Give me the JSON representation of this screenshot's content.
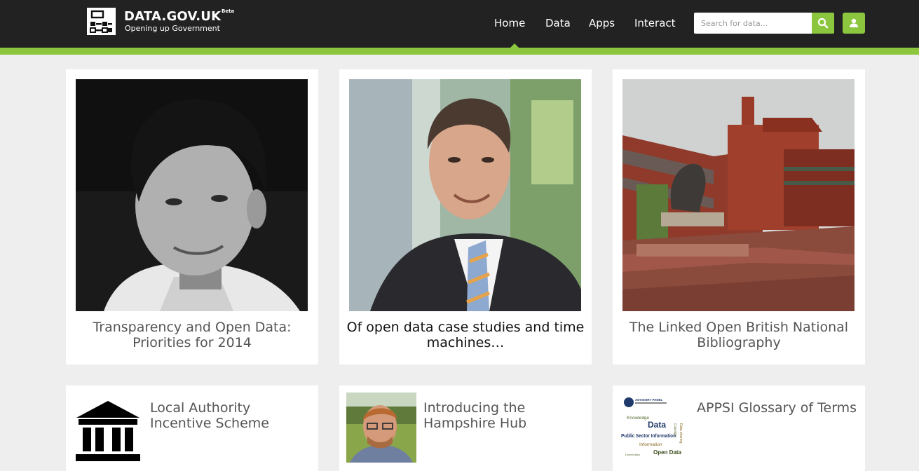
{
  "header": {
    "logo_title": "DATA.GOV.UK",
    "logo_beta": "Beta",
    "logo_tagline": "Opening up Government",
    "nav": [
      "Home",
      "Data",
      "Apps",
      "Interact"
    ],
    "active_nav": "Home",
    "search_placeholder": "Search for data...",
    "search_icon": "search-icon",
    "user_icon": "user-icon"
  },
  "colors": {
    "header_bg": "#222222",
    "accent": "#8cc63f",
    "page_bg": "#eeeeee"
  },
  "featured": [
    {
      "title": "Transparency and Open Data: Priorities for 2014",
      "image": "portrait-bw-man"
    },
    {
      "title": "Of open data case studies and time machines…",
      "image": "portrait-man-suit"
    },
    {
      "title": "The Linked Open British National Bibliography",
      "image": "british-library-building"
    }
  ],
  "secondary": [
    {
      "title": "Local Authority Incentive Scheme",
      "image": "building-icon"
    },
    {
      "title": "Introducing the Hampshire Hub",
      "image": "portrait-man-glasses"
    },
    {
      "title": "APPSI Glossary of Terms",
      "image": "word-cloud"
    }
  ],
  "wordcloud": {
    "header": "ADVISORY PANEL",
    "words": [
      "Knowledge",
      "Data",
      "Public Sector Information",
      "Information",
      "Open Data",
      "Linked data",
      "Data sharing",
      "Copyright"
    ]
  }
}
